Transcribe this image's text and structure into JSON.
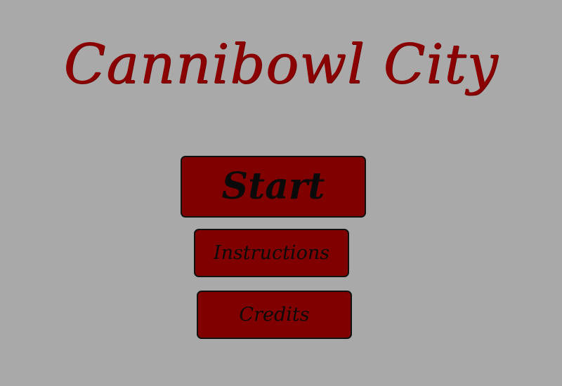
{
  "game": {
    "title": "Cannibowl City"
  },
  "menu": {
    "start_label": "Start",
    "instructions_label": "Instructions",
    "credits_label": "Credits"
  },
  "colors": {
    "background": "#a9a9a9",
    "title": "#8b0000",
    "button_fill": "#800000",
    "button_border": "#111111",
    "button_text": "#0a0a0a"
  }
}
